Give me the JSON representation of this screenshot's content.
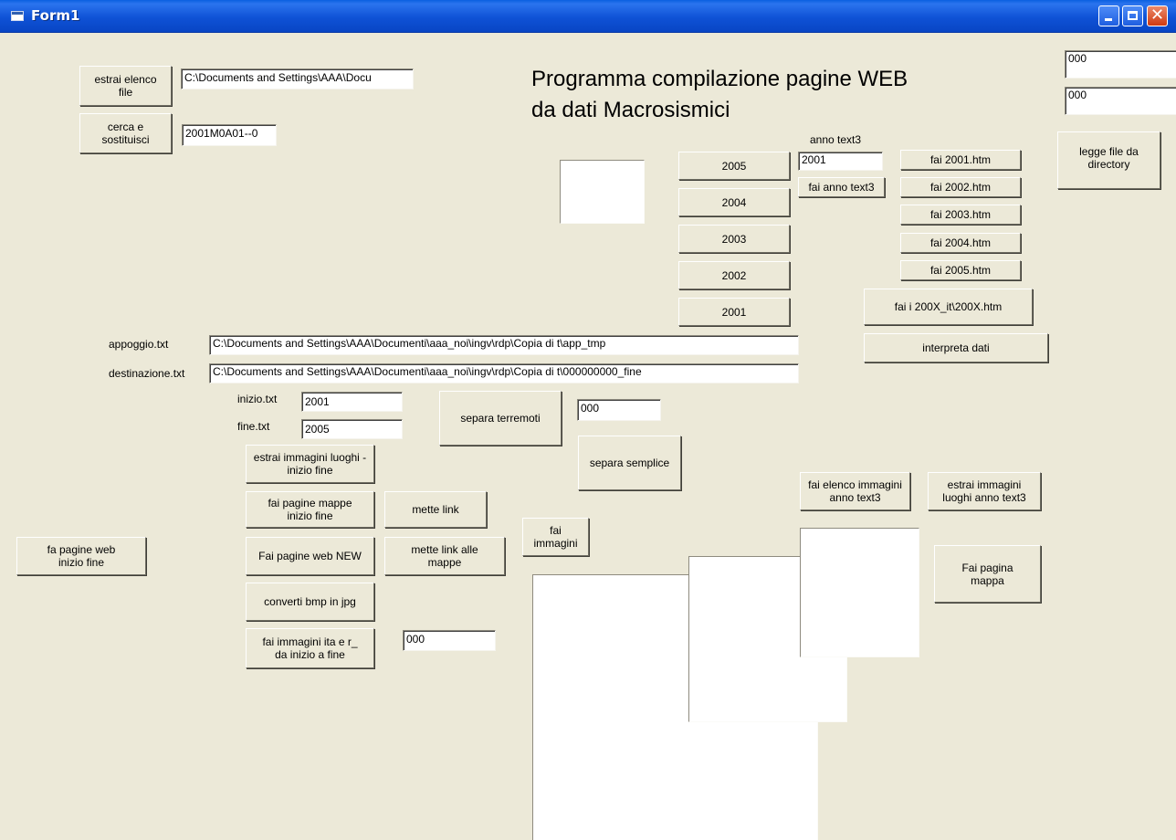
{
  "window": {
    "title": "Form1"
  },
  "heading": "Programma compilazione pagine WEB\nda dati Macrosismici",
  "buttons": {
    "estrai_elenco_file": "estrai elenco\nfile",
    "cerca_sostituisci": "cerca e\nsostituisci",
    "year_2005": "2005",
    "year_2004": "2004",
    "year_2003": "2003",
    "year_2002": "2002",
    "year_2001": "2001",
    "fai_anno_text3": "fai anno text3",
    "fai_2001_htm": "fai 2001.htm",
    "fai_2002_htm": "fai 2002.htm",
    "fai_2003_htm": "fai 2003.htm",
    "fai_2004_htm": "fai 2004.htm",
    "fai_2005_htm": "fai 2005.htm",
    "fai_200x_it": "fai i 200X_it\\200X.htm",
    "interpreta_dati": "interpreta dati",
    "legge_file_directory": "legge file da\ndirectory",
    "separa_terremoti": "separa terremoti",
    "separa_semplice": "separa semplice",
    "estrai_immagini_luoghi": "estrai immagini luoghi -\ninizio fine",
    "fai_pagine_mappe": "fai pagine mappe\ninizio fine",
    "mette_link": "mette link",
    "fai_immagini": "fai\nimmagini",
    "fa_pagine_web": "fa pagine web\ninizio fine",
    "fai_pagine_web_new": "Fai pagine web NEW",
    "mette_link_mappe": "mette link alle\nmappe",
    "converti_bmp_jpg": "converti bmp in jpg",
    "fai_immagini_ita": "fai immagini ita e r_\nda inizio a fine",
    "fai_elenco_immagini": "fai elenco immagini\nanno text3",
    "estrai_immagini_anno": "estrai immagini\nluoghi anno text3",
    "fai_pagina_mappa": "Fai pagina\nmappa"
  },
  "labels": {
    "anno_text3": "anno text3",
    "appoggio": "appoggio.txt",
    "destinazione": "destinazione.txt",
    "inizio": "inizio.txt",
    "fine": "fine.txt"
  },
  "fields": {
    "path_docs": "C:\\Documents and Settings\\AAA\\Docu",
    "search_code": "2001M0A01--0",
    "anno_value": "2001",
    "top_right_1": "000",
    "top_right_2": "000",
    "appoggio_path": "C:\\Documents and Settings\\AAA\\Documenti\\aaa_noi\\ingv\\rdp\\Copia di t\\app_tmp",
    "destinazione_path": "C:\\Documents and Settings\\AAA\\Documenti\\aaa_noi\\ingv\\rdp\\Copia di t\\000000000_fine",
    "inizio_value": "2001",
    "fine_value": "2005",
    "separa_counter": "000",
    "immagini_counter": "000"
  }
}
